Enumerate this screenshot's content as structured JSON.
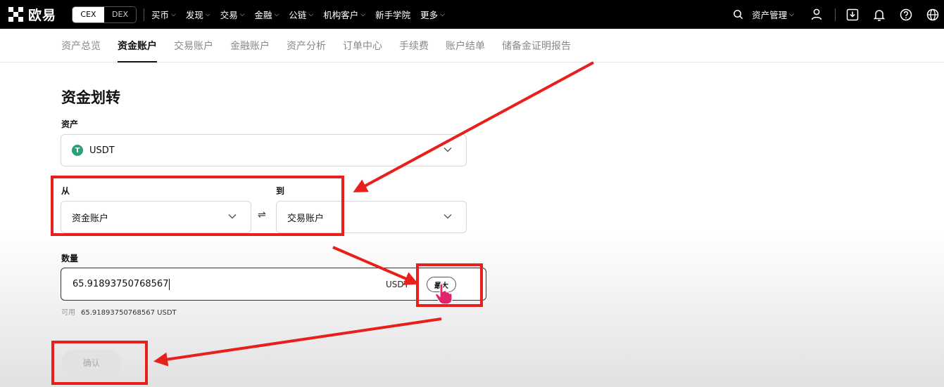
{
  "topbar": {
    "logo_text": "欧易",
    "segments": [
      "CEX",
      "DEX"
    ],
    "nav": [
      "买币",
      "发现",
      "交易",
      "金融",
      "公链",
      "机构客户",
      "新手学院",
      "更多"
    ],
    "nav_caret": [
      "yes",
      "yes",
      "yes",
      "yes",
      "yes",
      "yes",
      "no",
      "yes"
    ],
    "asset_management": "资产管理",
    "icons": [
      "search-icon",
      "user-icon",
      "download-icon",
      "bell-icon",
      "help-icon",
      "globe-icon"
    ]
  },
  "subnav": {
    "tabs": [
      "资产总览",
      "资金账户",
      "交易账户",
      "金融账户",
      "资产分析",
      "订单中心",
      "手续费",
      "账户结单",
      "储备金证明报告"
    ],
    "active": "资金账户"
  },
  "form": {
    "title": "资金划转",
    "asset_label": "资产",
    "asset_value": "USDT",
    "asset_icon_letter": "T",
    "from_label": "从",
    "from_value": "资金账户",
    "to_label": "到",
    "to_value": "交易账户",
    "amount_label": "数量",
    "amount_value": "65.91893750768567",
    "amount_unit": "USDT",
    "max_label": "最大",
    "available_label": "可用",
    "available_value": "65.91893750768567 USDT",
    "confirm_label": "确认"
  },
  "colors": {
    "annotation": "#e8201c",
    "tether": "#26a17b"
  }
}
